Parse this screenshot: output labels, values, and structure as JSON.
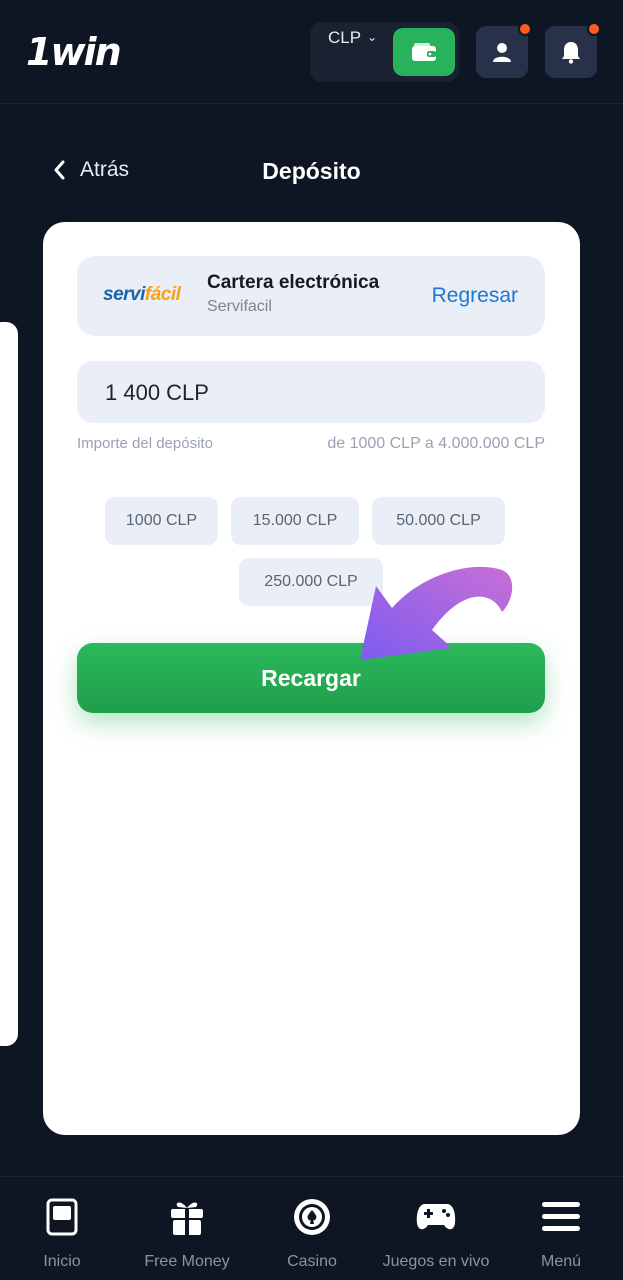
{
  "header": {
    "logo": "1win",
    "currency": "CLP",
    "colors": {
      "wallet_green": "#27b25b",
      "notification_dot": "#ff5a1f"
    },
    "icons": [
      "wallet-icon",
      "user-icon",
      "bell-icon",
      "chevron-down-icon"
    ]
  },
  "page": {
    "back_label": "Atrás",
    "title": "Depósito"
  },
  "method": {
    "logo_text_main": "servi",
    "logo_text_accent": "fácil",
    "name": "Cartera electrónica",
    "provider": "Servifacil",
    "change_label": "Regresar"
  },
  "deposit": {
    "amount_value": "1 400 CLP",
    "amount_label": "Importe del depósito",
    "range_label": "de 1000 CLP a 4.000.000 CLP",
    "presets": [
      "1000 CLP",
      "15.000 CLP",
      "50.000 CLP",
      "250.000 CLP"
    ],
    "submit_label": "Recargar"
  },
  "bottom_nav": {
    "items": [
      {
        "label": "Inicio",
        "icon": "home-icon"
      },
      {
        "label": "Free Money",
        "icon": "gift-icon"
      },
      {
        "label": "Casino",
        "icon": "casino-chip-icon"
      },
      {
        "label": "Juegos en vivo",
        "icon": "gamepad-icon"
      },
      {
        "label": "Menú",
        "icon": "menu-icon"
      }
    ]
  }
}
